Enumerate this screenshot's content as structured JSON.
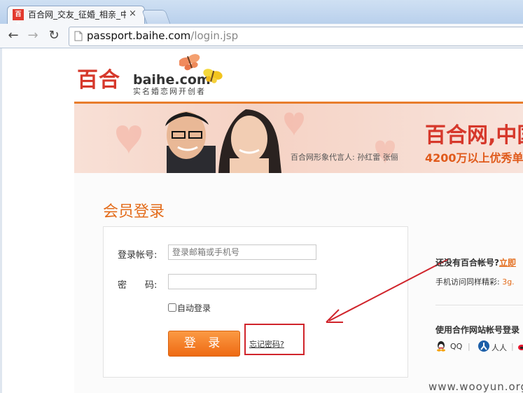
{
  "browser": {
    "tab_title": "百合网_交友_征婚_相亲_中",
    "tab_close": "×",
    "favicon_text": "百合",
    "url_host": "passport.baihe.com",
    "url_path": "/login.jsp",
    "back_icon": "←",
    "forward_icon": "→",
    "reload_icon": "↻"
  },
  "logo": {
    "main": "百合",
    "domain": "baihe.com",
    "tagline": "实名婚恋网开创者"
  },
  "banner": {
    "slogan": "百合网,中国",
    "caption": "百合网形象代言人: 孙红雷 张俪",
    "members": "4200万以上优秀单"
  },
  "login": {
    "title": "会员登录",
    "account_label": "登录帐号:",
    "account_placeholder": "登录邮箱或手机号",
    "password_label": "密　　码:",
    "autologin_label": "自动登录",
    "login_button": "登 录",
    "forgot_link": "忘记密码?"
  },
  "side": {
    "no_account": "还没有百合帐号?",
    "register_link": "立即",
    "mobile_text": "手机访问同样精彩: ",
    "mobile_link": "3g.",
    "partner_title": "使用合作网站帐号登录",
    "partners": [
      "QQ",
      "人人"
    ],
    "separator": "|"
  },
  "watermark": "www.wooyun.org",
  "colors": {
    "brand_red": "#d6382b",
    "accent_orange": "#e36c1b",
    "annotation_red": "#d0242b"
  }
}
